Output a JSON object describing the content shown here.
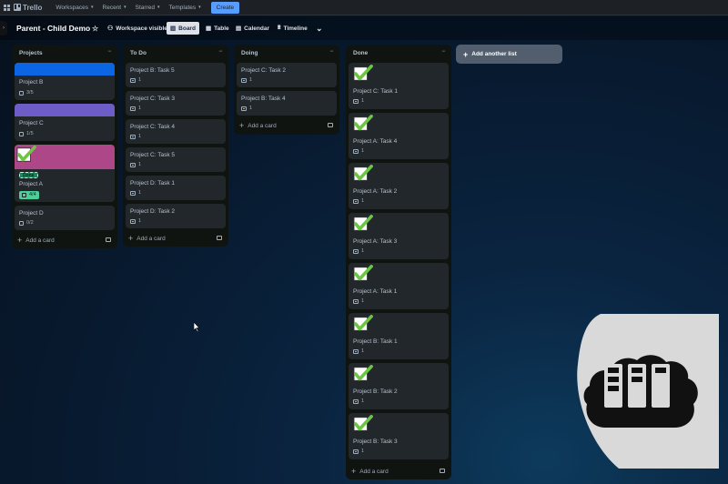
{
  "topnav": {
    "brand": "Trello",
    "items": [
      "Workspaces",
      "Recent",
      "Starred",
      "Templates"
    ],
    "create_label": "Create"
  },
  "board": {
    "title": "Parent - Child Demo",
    "visibility": "Workspace visible",
    "views": [
      "Board",
      "Table",
      "Calendar",
      "Timeline"
    ],
    "active_view": "Board"
  },
  "lists": {
    "projects": {
      "title": "Projects",
      "cards": [
        {
          "title": "Project B",
          "badge": "3/5",
          "cover": "#0c66e4"
        },
        {
          "title": "Project C",
          "badge": "1/5",
          "cover": "#6e5dc6"
        },
        {
          "title": "Project A",
          "badge": "4/4",
          "cover": "#ae4787",
          "label": "Done"
        },
        {
          "title": "Project D",
          "badge": "0/2"
        }
      ],
      "add_label": "Add a card"
    },
    "todo": {
      "title": "To Do",
      "cards": [
        {
          "title": "Project B: Task 5",
          "badge": "1"
        },
        {
          "title": "Project C: Task 3",
          "badge": "1"
        },
        {
          "title": "Project C: Task 4",
          "badge": "1"
        },
        {
          "title": "Project C: Task 5",
          "badge": "1"
        },
        {
          "title": "Project D: Task 1",
          "badge": "1"
        },
        {
          "title": "Project D: Task 2",
          "badge": "1"
        }
      ],
      "add_label": "Add a card"
    },
    "doing": {
      "title": "Doing",
      "cards": [
        {
          "title": "Project C: Task 2",
          "badge": "1"
        },
        {
          "title": "Project B: Task 4",
          "badge": "1"
        }
      ],
      "add_label": "Add a card"
    },
    "done": {
      "title": "Done",
      "cards": [
        {
          "title": "Project C: Task 1",
          "badge": "1"
        },
        {
          "title": "Project A: Task 4",
          "badge": "1"
        },
        {
          "title": "Project A: Task 2",
          "badge": "1"
        },
        {
          "title": "Project A: Task 3",
          "badge": "1"
        },
        {
          "title": "Project A: Task 1",
          "badge": "1"
        },
        {
          "title": "Project B: Task 1",
          "badge": "1"
        },
        {
          "title": "Project B: Task 2",
          "badge": "1"
        },
        {
          "title": "Project B: Task 3",
          "badge": "1"
        }
      ],
      "add_label": "Add a card"
    }
  },
  "add_list_label": "Add another list",
  "colors": {
    "accent": "#579dff",
    "check_green": "#6cc644",
    "cl_badge": "#4bce97"
  }
}
